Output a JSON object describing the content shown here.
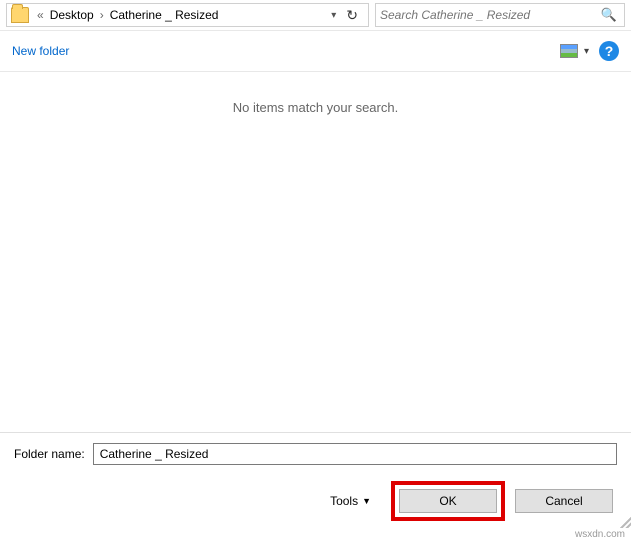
{
  "breadcrumb": {
    "prefix": "«",
    "segments": [
      "Desktop",
      "Catherine _ Resized"
    ],
    "separator": "›"
  },
  "search": {
    "placeholder": "Search Catherine _ Resized"
  },
  "command_bar": {
    "new_folder": "New folder"
  },
  "content": {
    "empty_message": "No items match your search."
  },
  "footer": {
    "folder_name_label": "Folder name:",
    "folder_name_value": "Catherine _ Resized",
    "tools_label": "Tools",
    "ok_label": "OK",
    "cancel_label": "Cancel"
  },
  "watermark": "wsxdn.com",
  "help_glyph": "?"
}
